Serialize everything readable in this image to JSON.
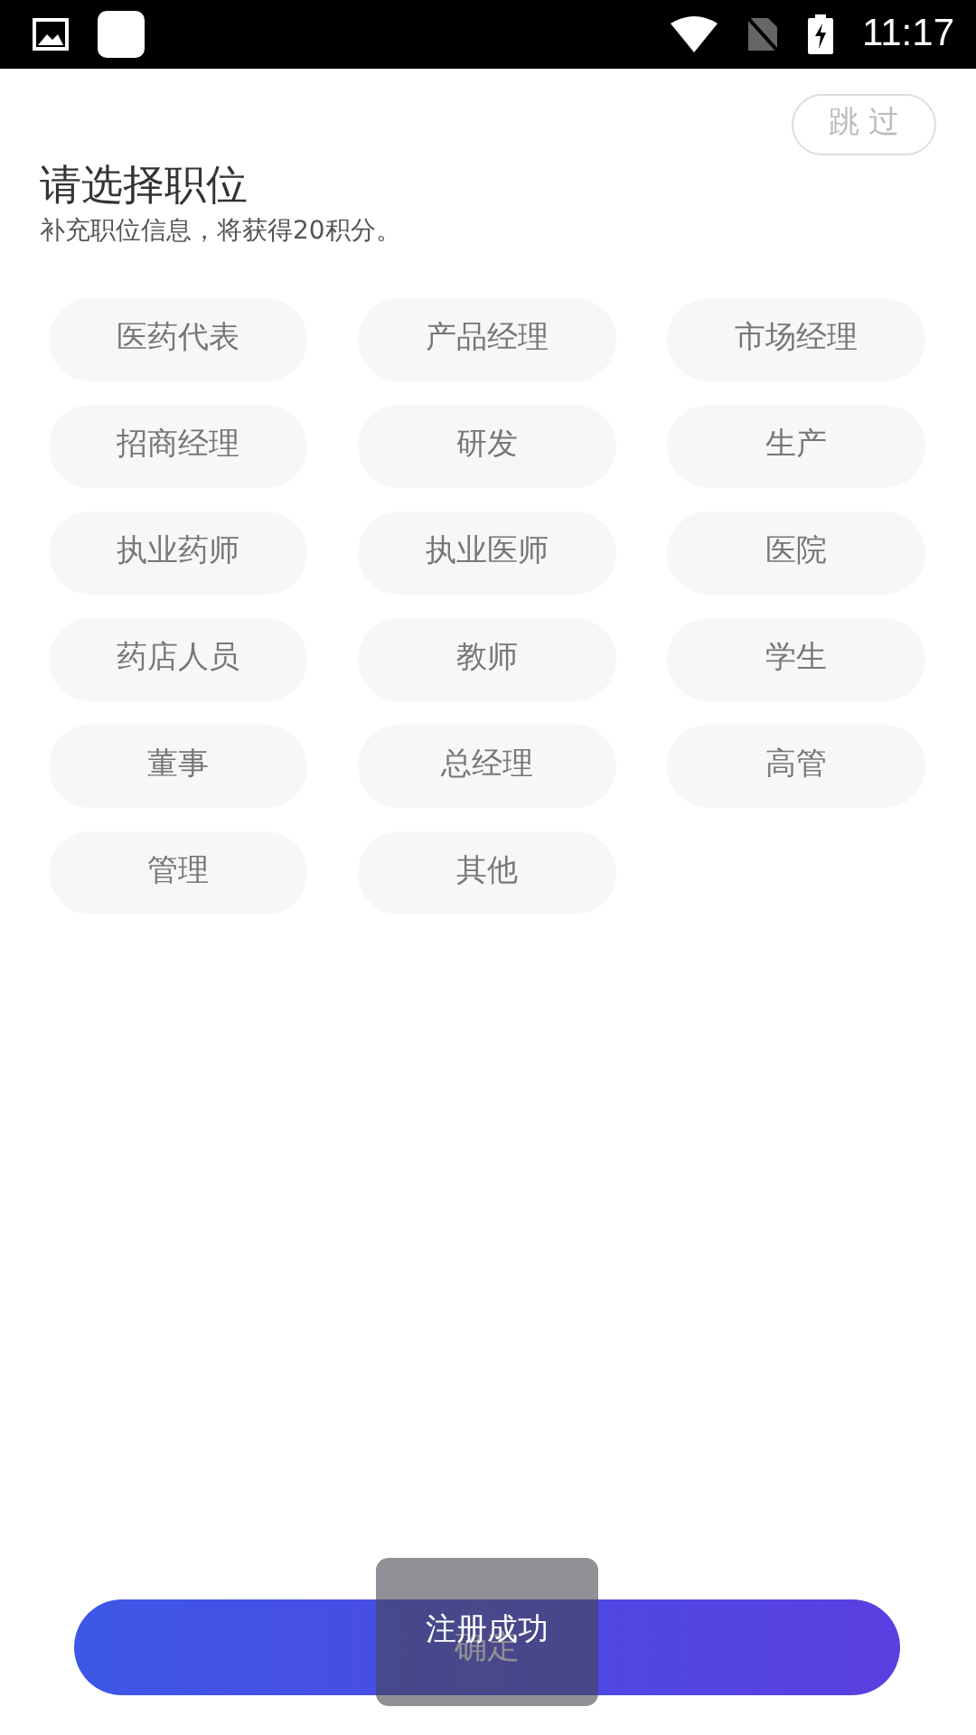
{
  "status_bar": {
    "time": "11:17"
  },
  "skip_button": {
    "label": "跳 过"
  },
  "title": "请选择职位",
  "subtitle": "补充职位信息，将获得20积分。",
  "positions": [
    {
      "label": "医药代表",
      "selected": false
    },
    {
      "label": "产品经理",
      "selected": false
    },
    {
      "label": "市场经理",
      "selected": false
    },
    {
      "label": "招商经理",
      "selected": false
    },
    {
      "label": "研发",
      "selected": false
    },
    {
      "label": "生产",
      "selected": false
    },
    {
      "label": "执业药师",
      "selected": false
    },
    {
      "label": "执业医师",
      "selected": false
    },
    {
      "label": "医院",
      "selected": false
    },
    {
      "label": "药店人员",
      "selected": false
    },
    {
      "label": "教师",
      "selected": false
    },
    {
      "label": "学生",
      "selected": false
    },
    {
      "label": "董事",
      "selected": false
    },
    {
      "label": "总经理",
      "selected": false
    },
    {
      "label": "高管",
      "selected": false
    },
    {
      "label": "管理",
      "selected": false
    },
    {
      "label": "其他",
      "selected": false
    }
  ],
  "confirm_button": {
    "label": "确定"
  },
  "toast": {
    "text": "注册成功"
  }
}
